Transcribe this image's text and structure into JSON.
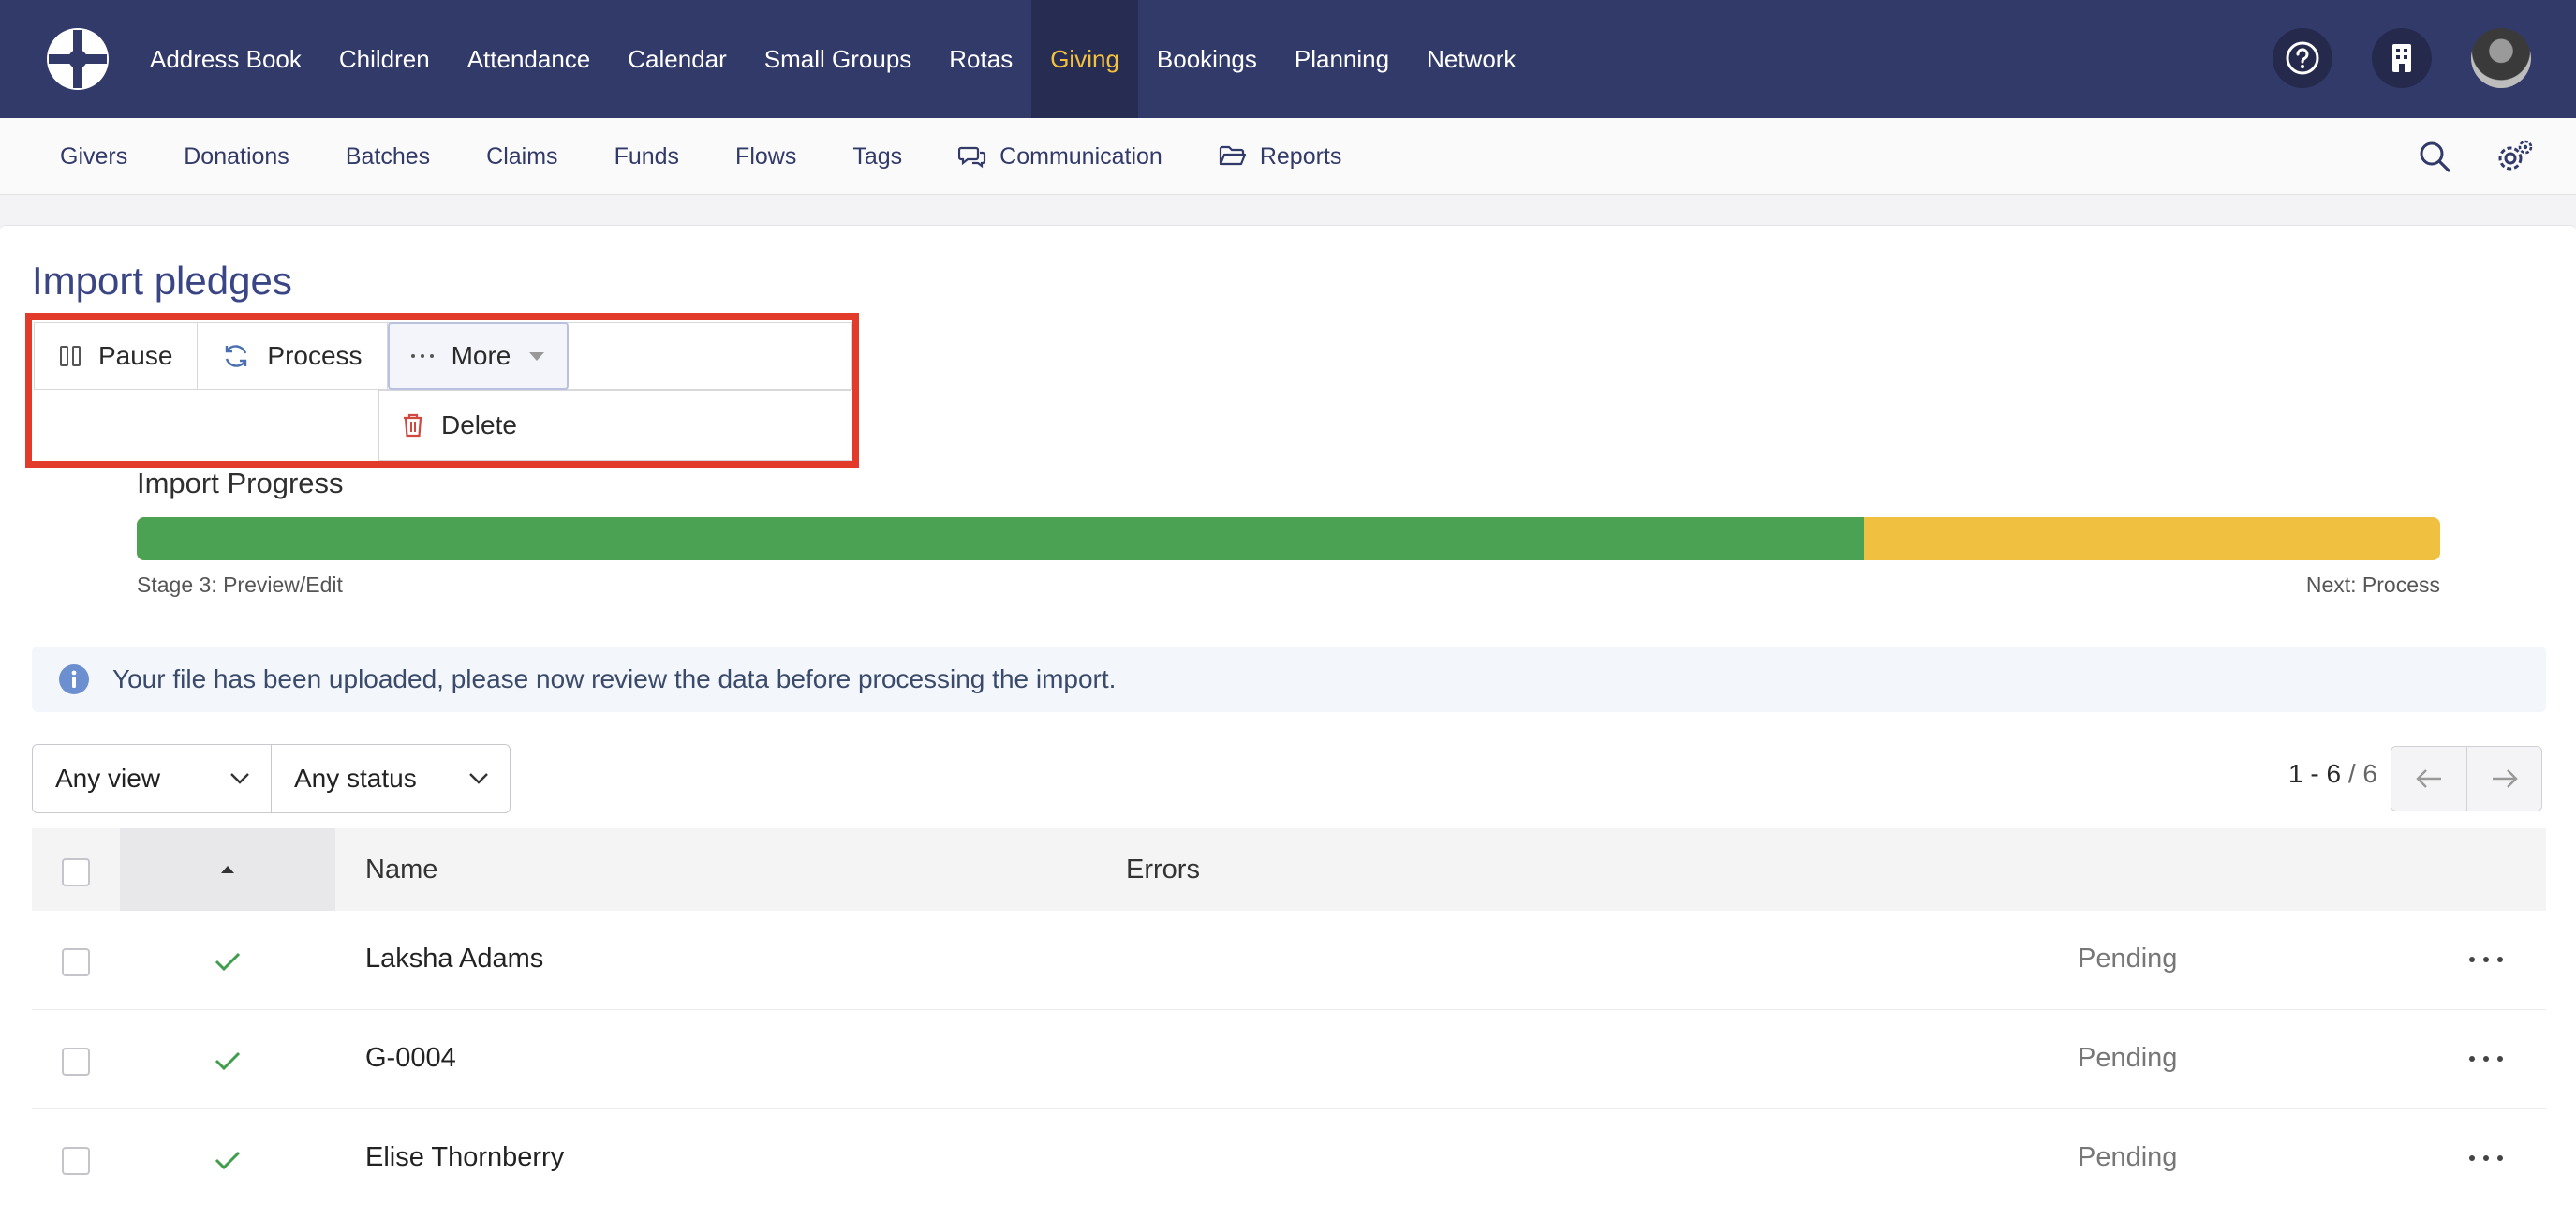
{
  "topnav": {
    "items": [
      "Address Book",
      "Children",
      "Attendance",
      "Calendar",
      "Small Groups",
      "Rotas",
      "Giving",
      "Bookings",
      "Planning",
      "Network"
    ],
    "active": "Giving"
  },
  "subnav": {
    "items": [
      {
        "label": "Givers",
        "icon": ""
      },
      {
        "label": "Donations",
        "icon": ""
      },
      {
        "label": "Batches",
        "icon": ""
      },
      {
        "label": "Claims",
        "icon": ""
      },
      {
        "label": "Funds",
        "icon": ""
      },
      {
        "label": "Flows",
        "icon": ""
      },
      {
        "label": "Tags",
        "icon": ""
      },
      {
        "label": "Communication",
        "icon": "chat-icon"
      },
      {
        "label": "Reports",
        "icon": "folder-icon"
      }
    ]
  },
  "page": {
    "title": "Import pledges"
  },
  "toolbar": {
    "pause_label": "Pause",
    "process_label": "Process",
    "more_label": "More",
    "delete_label": "Delete"
  },
  "progress": {
    "label": "Import Progress",
    "complete_fraction": 0.75,
    "stage_text": "Stage 3: Preview/Edit",
    "next_text": "Next: Process"
  },
  "info": {
    "message": "Your file has been uploaded, please now review the data before processing the import."
  },
  "filters": {
    "view": "Any view",
    "status": "Any status"
  },
  "pager": {
    "range": "1 - 6",
    "total": " / 6"
  },
  "table": {
    "headers": {
      "name": "Name",
      "errors": "Errors"
    },
    "rows": [
      {
        "name": "Laksha Adams",
        "status": "Pending"
      },
      {
        "name": "G-0004",
        "status": "Pending"
      },
      {
        "name": "Elise Thornberry",
        "status": "Pending"
      }
    ]
  },
  "colors": {
    "topbar": "#323a6a",
    "active_nav": "#f4c13d",
    "progress_done": "#4ba252",
    "progress_remaining": "#f0c040",
    "highlight": "#e23b2c"
  }
}
